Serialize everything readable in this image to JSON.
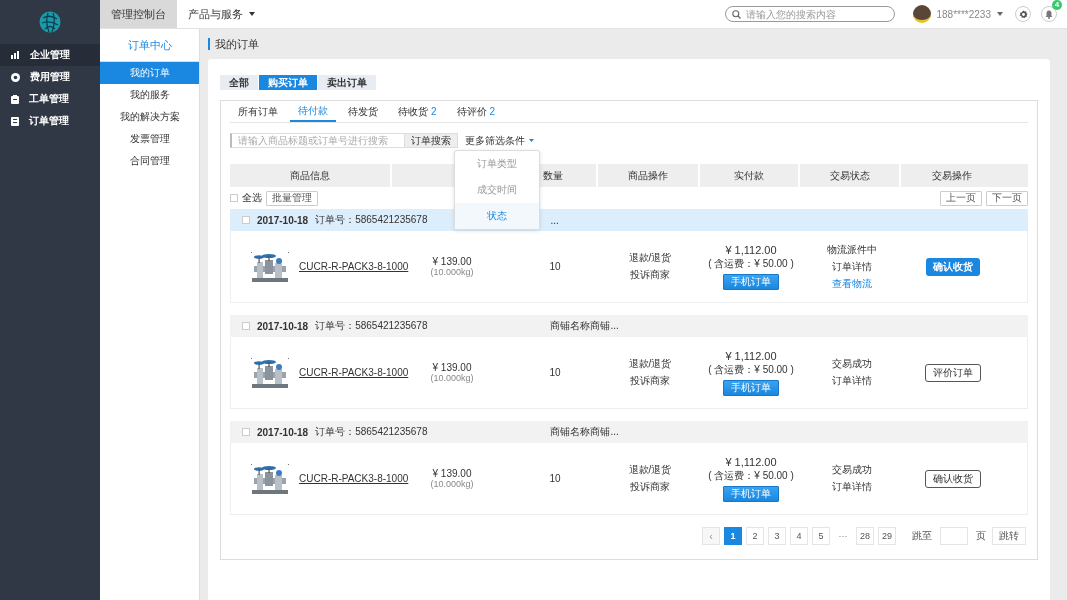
{
  "sidebar": {
    "items": [
      {
        "label": "企业管理",
        "selected": true
      },
      {
        "label": "费用管理",
        "selected": false
      },
      {
        "label": "工单管理",
        "selected": false
      },
      {
        "label": "订单管理",
        "selected": false
      }
    ]
  },
  "topbar": {
    "tabs": [
      {
        "label": "管理控制台",
        "selected": true,
        "has_menu": false
      },
      {
        "label": "产品与服务",
        "selected": false,
        "has_menu": true
      }
    ],
    "search": {
      "placeholder": "请输入您的搜索内容"
    },
    "user": "188****2233",
    "notifications": "4"
  },
  "submenu": {
    "title": "订单中心",
    "items": [
      {
        "label": "我的订单",
        "selected": true
      },
      {
        "label": "我的服务",
        "selected": false
      },
      {
        "label": "我的解决方案",
        "selected": false
      },
      {
        "label": "发票管理",
        "selected": false
      },
      {
        "label": "合同管理",
        "selected": false
      }
    ]
  },
  "page_title": "我的订单",
  "order_types": [
    {
      "label": "全部",
      "selected": false
    },
    {
      "label": "购买订单",
      "selected": true
    },
    {
      "label": "卖出订单",
      "selected": false
    }
  ],
  "status_tabs": [
    {
      "label": "所有订单",
      "selected": false
    },
    {
      "label": "待付款",
      "selected": true
    },
    {
      "label": "待发货",
      "selected": false
    },
    {
      "label": "待收货",
      "count": "2",
      "selected": false
    },
    {
      "label": "待评价",
      "count": "2",
      "selected": false
    }
  ],
  "search": {
    "placeholder": "请输入商品标题或订单号进行搜索",
    "button": "订单搜索",
    "filter": "更多筛选条件"
  },
  "filter_menu": {
    "items": [
      {
        "label": "订单类型",
        "selected": false
      },
      {
        "label": "成交时间",
        "selected": false
      },
      {
        "label": "状态",
        "selected": true
      }
    ]
  },
  "table": {
    "columns": [
      {
        "label": "商品信息"
      },
      {},
      {
        "label": "数量"
      },
      {
        "label": "商品操作"
      },
      {
        "label": "实付款"
      },
      {
        "label": "交易状态"
      },
      {
        "label": "交易操作"
      }
    ],
    "select_all": {
      "label": "全选",
      "checked": false
    },
    "batch_button": "批量管理",
    "prev_button": "上一页",
    "next_button": "下一页"
  },
  "orders": [
    {
      "selected": true,
      "checked": false,
      "date": "2017-10-18",
      "order_no": "订单号：5865421235678",
      "store": "...",
      "product": "CUCR-R-PACK3-8-1000",
      "price": "¥ 139.00",
      "weight": "(10.000kg)",
      "qty": "10",
      "actions": [
        "退款/退货",
        "投诉商家"
      ],
      "total": "¥ 1,112.00",
      "shipping": "( 含运费：¥ 50.00 )",
      "mobile_button": "手机订单",
      "status": [
        {
          "text": "物流派件中",
          "kind": "text"
        },
        {
          "text": "订单详情",
          "kind": "text"
        },
        {
          "text": "查看物流",
          "kind": "link"
        }
      ],
      "action": {
        "label": "确认收货",
        "kind": "primary"
      }
    },
    {
      "selected": false,
      "checked": false,
      "date": "2017-10-18",
      "order_no": "订单号：5865421235678",
      "store": "商铺名称商铺...",
      "product": "CUCR-R-PACK3-8-1000",
      "price": "¥ 139.00",
      "weight": "(10.000kg)",
      "qty": "10",
      "actions": [
        "退款/退货",
        "投诉商家"
      ],
      "total": "¥ 1,112.00",
      "shipping": "( 含运费：¥ 50.00 )",
      "mobile_button": "手机订单",
      "status": [
        {
          "text": "交易成功",
          "kind": "text"
        },
        {
          "text": "订单详情",
          "kind": "text"
        }
      ],
      "action": {
        "label": "评价订单",
        "kind": "outline"
      }
    },
    {
      "selected": false,
      "checked": false,
      "date": "2017-10-18",
      "order_no": "订单号：5865421235678",
      "store": "商铺名称商铺...",
      "product": "CUCR-R-PACK3-8-1000",
      "price": "¥ 139.00",
      "weight": "(10.000kg)",
      "qty": "10",
      "actions": [
        "退款/退货",
        "投诉商家"
      ],
      "total": "¥ 1,112.00",
      "shipping": "( 含运费：¥ 50.00 )",
      "mobile_button": "手机订单",
      "status": [
        {
          "text": "交易成功",
          "kind": "text"
        },
        {
          "text": "订单详情",
          "kind": "text"
        }
      ],
      "action": {
        "label": "确认收货",
        "kind": "outline"
      }
    }
  ],
  "pager": {
    "prev": {
      "label": "‹",
      "disabled": true
    },
    "pages": [
      {
        "label": "1",
        "kind": "page",
        "selected": true
      },
      {
        "label": "2",
        "kind": "page",
        "selected": false
      },
      {
        "label": "3",
        "kind": "page",
        "selected": false
      },
      {
        "label": "4",
        "kind": "page",
        "selected": false
      },
      {
        "label": "5",
        "kind": "page",
        "selected": false
      },
      {
        "label": "···",
        "kind": "ellipsis"
      },
      {
        "label": "28",
        "kind": "page",
        "selected": false
      },
      {
        "label": "29",
        "kind": "page",
        "selected": false
      }
    ],
    "jump_label": "跳至",
    "unit": "页",
    "go_button": "跳转"
  }
}
